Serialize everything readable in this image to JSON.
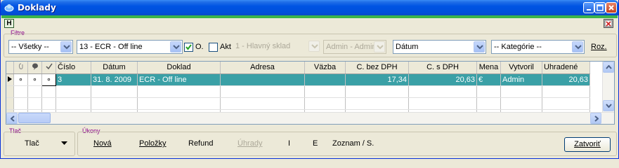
{
  "window": {
    "title": "Doklady"
  },
  "toolbar": {
    "h_label": "H"
  },
  "filters": {
    "group_label": "Filtre",
    "combo1": "-- Všetky --",
    "combo2": "13 - ECR - Off line",
    "check_o_label": "O.",
    "check_o_checked": true,
    "check_akt_label": "Akt",
    "check_akt_checked": false,
    "warehouse": "1 - Hlavný sklad",
    "user": "Admin - Admin",
    "date": "Dátum",
    "category": "-- Kategórie --",
    "roz_label": "Roz."
  },
  "grid": {
    "columns": [
      "",
      "",
      "",
      "Číslo",
      "Dátum",
      "Doklad",
      "Adresa",
      "Väzba",
      "C. bez DPH",
      "C. s DPH",
      "Mena",
      "Vytvoril",
      "Uhradené"
    ],
    "rows": [
      {
        "c1": "∘",
        "c2": "∘",
        "c3": "∘",
        "cislo": "3",
        "datum": "31. 8. 2009",
        "doklad": "ECR - Off line",
        "adresa": "",
        "vazba": "",
        "bez_dph": "17,34",
        "s_dph": "20,63",
        "mena": "€",
        "vytvoril": "Admin",
        "uhradene": "20,63"
      }
    ]
  },
  "print": {
    "group_label": "Tlač",
    "label": "Tlač"
  },
  "actions": {
    "group_label": "Úkony",
    "nova": "Nová",
    "polozky": "Položky",
    "refund": "Refund",
    "uhrady": "Úhrady",
    "i": "I",
    "e": "E",
    "zoznam": "Zoznam / S.",
    "zatvorit": "Zatvoriť"
  },
  "colors": {
    "selected_row": "#3aa0a6",
    "accent_bar": "#3cb44a",
    "title_bar": "#0054e3"
  }
}
